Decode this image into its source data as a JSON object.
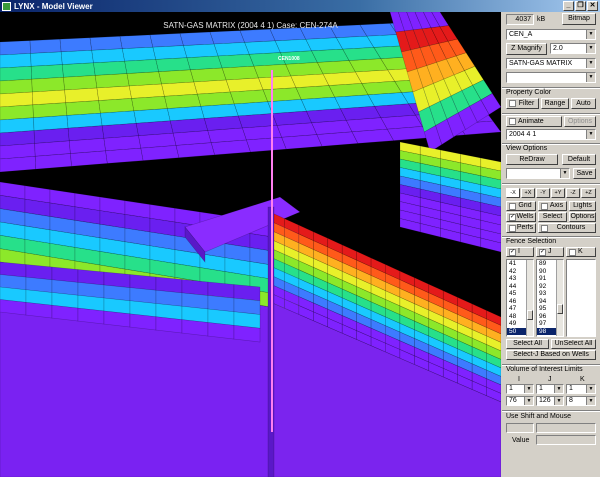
{
  "window": {
    "title": "LYNX - Model Viewer",
    "buttons": [
      "_",
      "❐",
      "✕"
    ]
  },
  "viewport": {
    "title": "SATN-GAS MATRIX (2004  4  1) Case: CEN-274A",
    "well_label": "CEN1008",
    "bands": [
      "#7f22ff",
      "#6a1ff0",
      "#3d7bff",
      "#19c9ff",
      "#27e08a",
      "#8ce82a",
      "#e8f02a",
      "#ffb020",
      "#ff5a1a",
      "#e41a1a"
    ]
  },
  "panel": {
    "memory_value": "4037",
    "memory_unit": "kB",
    "bitmap_label": "Bitmap",
    "case_select": "CEN_A",
    "z_magnify_label": "Z Magnify",
    "z_magnify_value": "2.0",
    "property_select": "SATN-GAS MATRIX",
    "blank_select": "",
    "property_color_label": "Property Color",
    "filter_label": "Filter",
    "range_label": "Range",
    "auto_label": "Auto",
    "animate_label": "Animate",
    "options_label": "Options",
    "date_value": "2004   4   1",
    "view_options_label": "View Options",
    "redraw_label": "ReDraw",
    "default_label": "Default",
    "save_label": "Save",
    "axis_buttons": [
      "-X",
      "+X",
      "-Y",
      "+Y",
      "-Z",
      "+Z"
    ],
    "grid_label": "Grid",
    "axis_label": "Axis",
    "lights_label": "Lights",
    "wells_label": "Wells",
    "select_label": "Select",
    "options2_label": "Options",
    "perfs_label": "Perfs",
    "contours_label": "Contours",
    "fence_selection_label": "Fence Selection",
    "i_label": "I",
    "j_label": "J",
    "k_label": "K",
    "i_list": [
      "41",
      "42",
      "43",
      "44",
      "45",
      "46",
      "47",
      "48",
      "49",
      "50"
    ],
    "i_selected": "50",
    "j_list": [
      "89",
      "90",
      "91",
      "92",
      "93",
      "94",
      "95",
      "96",
      "97",
      "98"
    ],
    "j_selected": "98",
    "select_all_label": "Select All",
    "unselect_all_label": "UnSelect All",
    "select_j_wells_label": "Select-J Based on Wells",
    "voi_label": "Volume of Interest Limits",
    "voi_i_label": "I",
    "voi_j_label": "J",
    "voi_k_label": "K",
    "voi_i_min": "1",
    "voi_j_min": "1",
    "voi_k_min": "1",
    "voi_i_max": "76",
    "voi_j_max": "126",
    "voi_k_max": "8",
    "shift_mouse_label": "Use Shift and Mouse",
    "value_label": "Value"
  }
}
